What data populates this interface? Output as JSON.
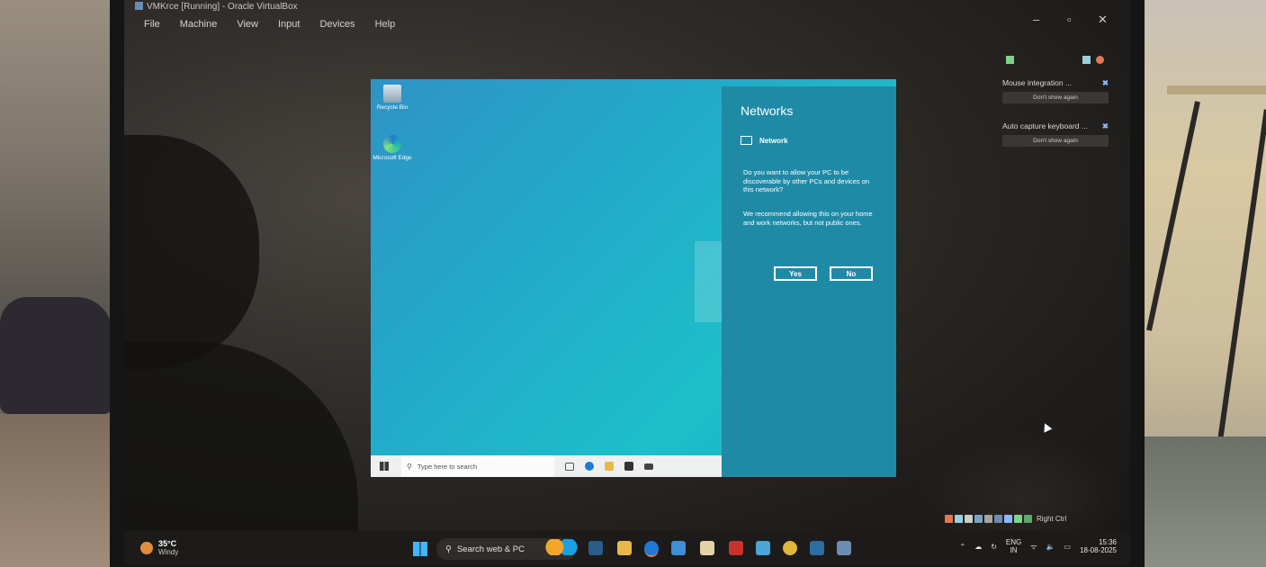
{
  "vbox": {
    "title": "VMKrce [Running] - Oracle VirtualBox",
    "menu": [
      "File",
      "Machine",
      "View",
      "Input",
      "Devices",
      "Help"
    ],
    "status_right_ctrl": "Right Ctrl"
  },
  "notifications": [
    {
      "text": "Mouse integration ...",
      "dont": "Don't show again"
    },
    {
      "text": "Auto capture keyboard ...",
      "dont": "Don't show again"
    }
  ],
  "vm_desktop": {
    "icons": [
      {
        "label": "Recycle Bin",
        "icon": "recycle-bin-icon"
      },
      {
        "label": "Microsoft Edge",
        "icon": "edge-icon"
      }
    ],
    "taskbar": {
      "search_placeholder": "Type here to search"
    }
  },
  "network_panel": {
    "title": "Networks",
    "network_name": "Network",
    "question": "Do you want to allow your PC to be discoverable by other PCs and devices on this network?",
    "recommendation": "We recommend allowing this on your home and work networks, but not public ones.",
    "yes": "Yes",
    "no": "No"
  },
  "host_taskbar": {
    "weather_temp": "35°C",
    "weather_desc": "Windy",
    "search_label": "Search web & PC",
    "lang_top": "ENG",
    "lang_bottom": "IN",
    "time": "15:36",
    "date": "18-08-2025"
  },
  "colors": {
    "vm_panel": "#1f8aa6",
    "vm_desktop": "#22a9c9",
    "host_taskbar": "#1c1b1a"
  }
}
